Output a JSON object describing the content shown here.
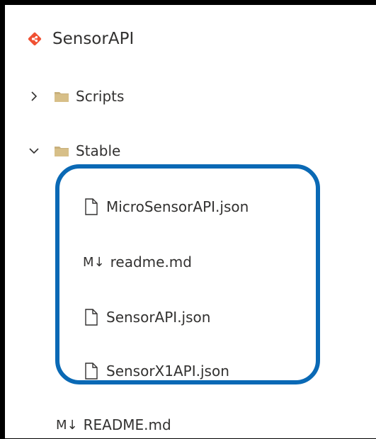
{
  "repo": {
    "name": "SensorAPI",
    "icon": "git-repo-icon",
    "icon_color": "#f05133"
  },
  "tree": {
    "folders": [
      {
        "label": "Scripts",
        "expanded": false,
        "icon": "folder-icon"
      },
      {
        "label": "Stable",
        "expanded": true,
        "icon": "folder-icon"
      }
    ],
    "stable_children": [
      {
        "label": "MicroSensorAPI.json",
        "type": "file",
        "icon": "file-icon"
      },
      {
        "label": "readme.md",
        "type": "markdown",
        "icon": "markdown-icon",
        "icon_text": "M↓"
      },
      {
        "label": "SensorAPI.json",
        "type": "file",
        "icon": "file-icon"
      },
      {
        "label": "SensorX1API.json",
        "type": "file",
        "icon": "file-icon"
      }
    ],
    "root_files": [
      {
        "label": "README.md",
        "type": "markdown",
        "icon": "markdown-icon",
        "icon_text": "M↓"
      }
    ]
  },
  "colors": {
    "folder": "#c8b07c",
    "highlight_border": "#0a69b5",
    "text": "#323130"
  }
}
